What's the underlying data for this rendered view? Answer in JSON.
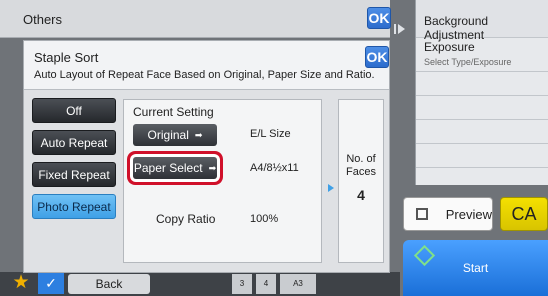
{
  "background": {
    "title": "Others",
    "ok_label": "OK",
    "right_panel": {
      "background_adjustment": "Background Adjustment",
      "exposure": "Exposure",
      "exposure_sub": "Select Type/Exposure"
    },
    "preview_label": "Preview",
    "ca_label": "CA",
    "start_label": "Start",
    "back_label": "Back",
    "tray_labels": [
      "3",
      "4",
      "A3"
    ]
  },
  "dialog": {
    "title": "Staple Sort",
    "subtitle": "Auto Layout of Repeat Face Based on Original, Paper Size and Ratio.",
    "ok_label": "OK",
    "modes": [
      "Off",
      "Auto Repeat",
      "Fixed Repeat",
      "Photo Repeat"
    ],
    "selected_mode": "Photo Repeat",
    "current_setting": {
      "heading": "Current Setting",
      "original_label": "Original",
      "original_value": "E/L Size",
      "paper_select_label": "Paper Select",
      "paper_select_value": "A4/8½x11",
      "copy_ratio_label": "Copy Ratio",
      "copy_ratio_value": "100%"
    },
    "faces": {
      "label": "No. of Faces",
      "value": "4"
    }
  },
  "colors": {
    "accent_blue": "#3fa0e6",
    "highlight_red": "#d0102a",
    "ca_yellow": "#f4e000",
    "start_blue": "#1a6fd8"
  }
}
